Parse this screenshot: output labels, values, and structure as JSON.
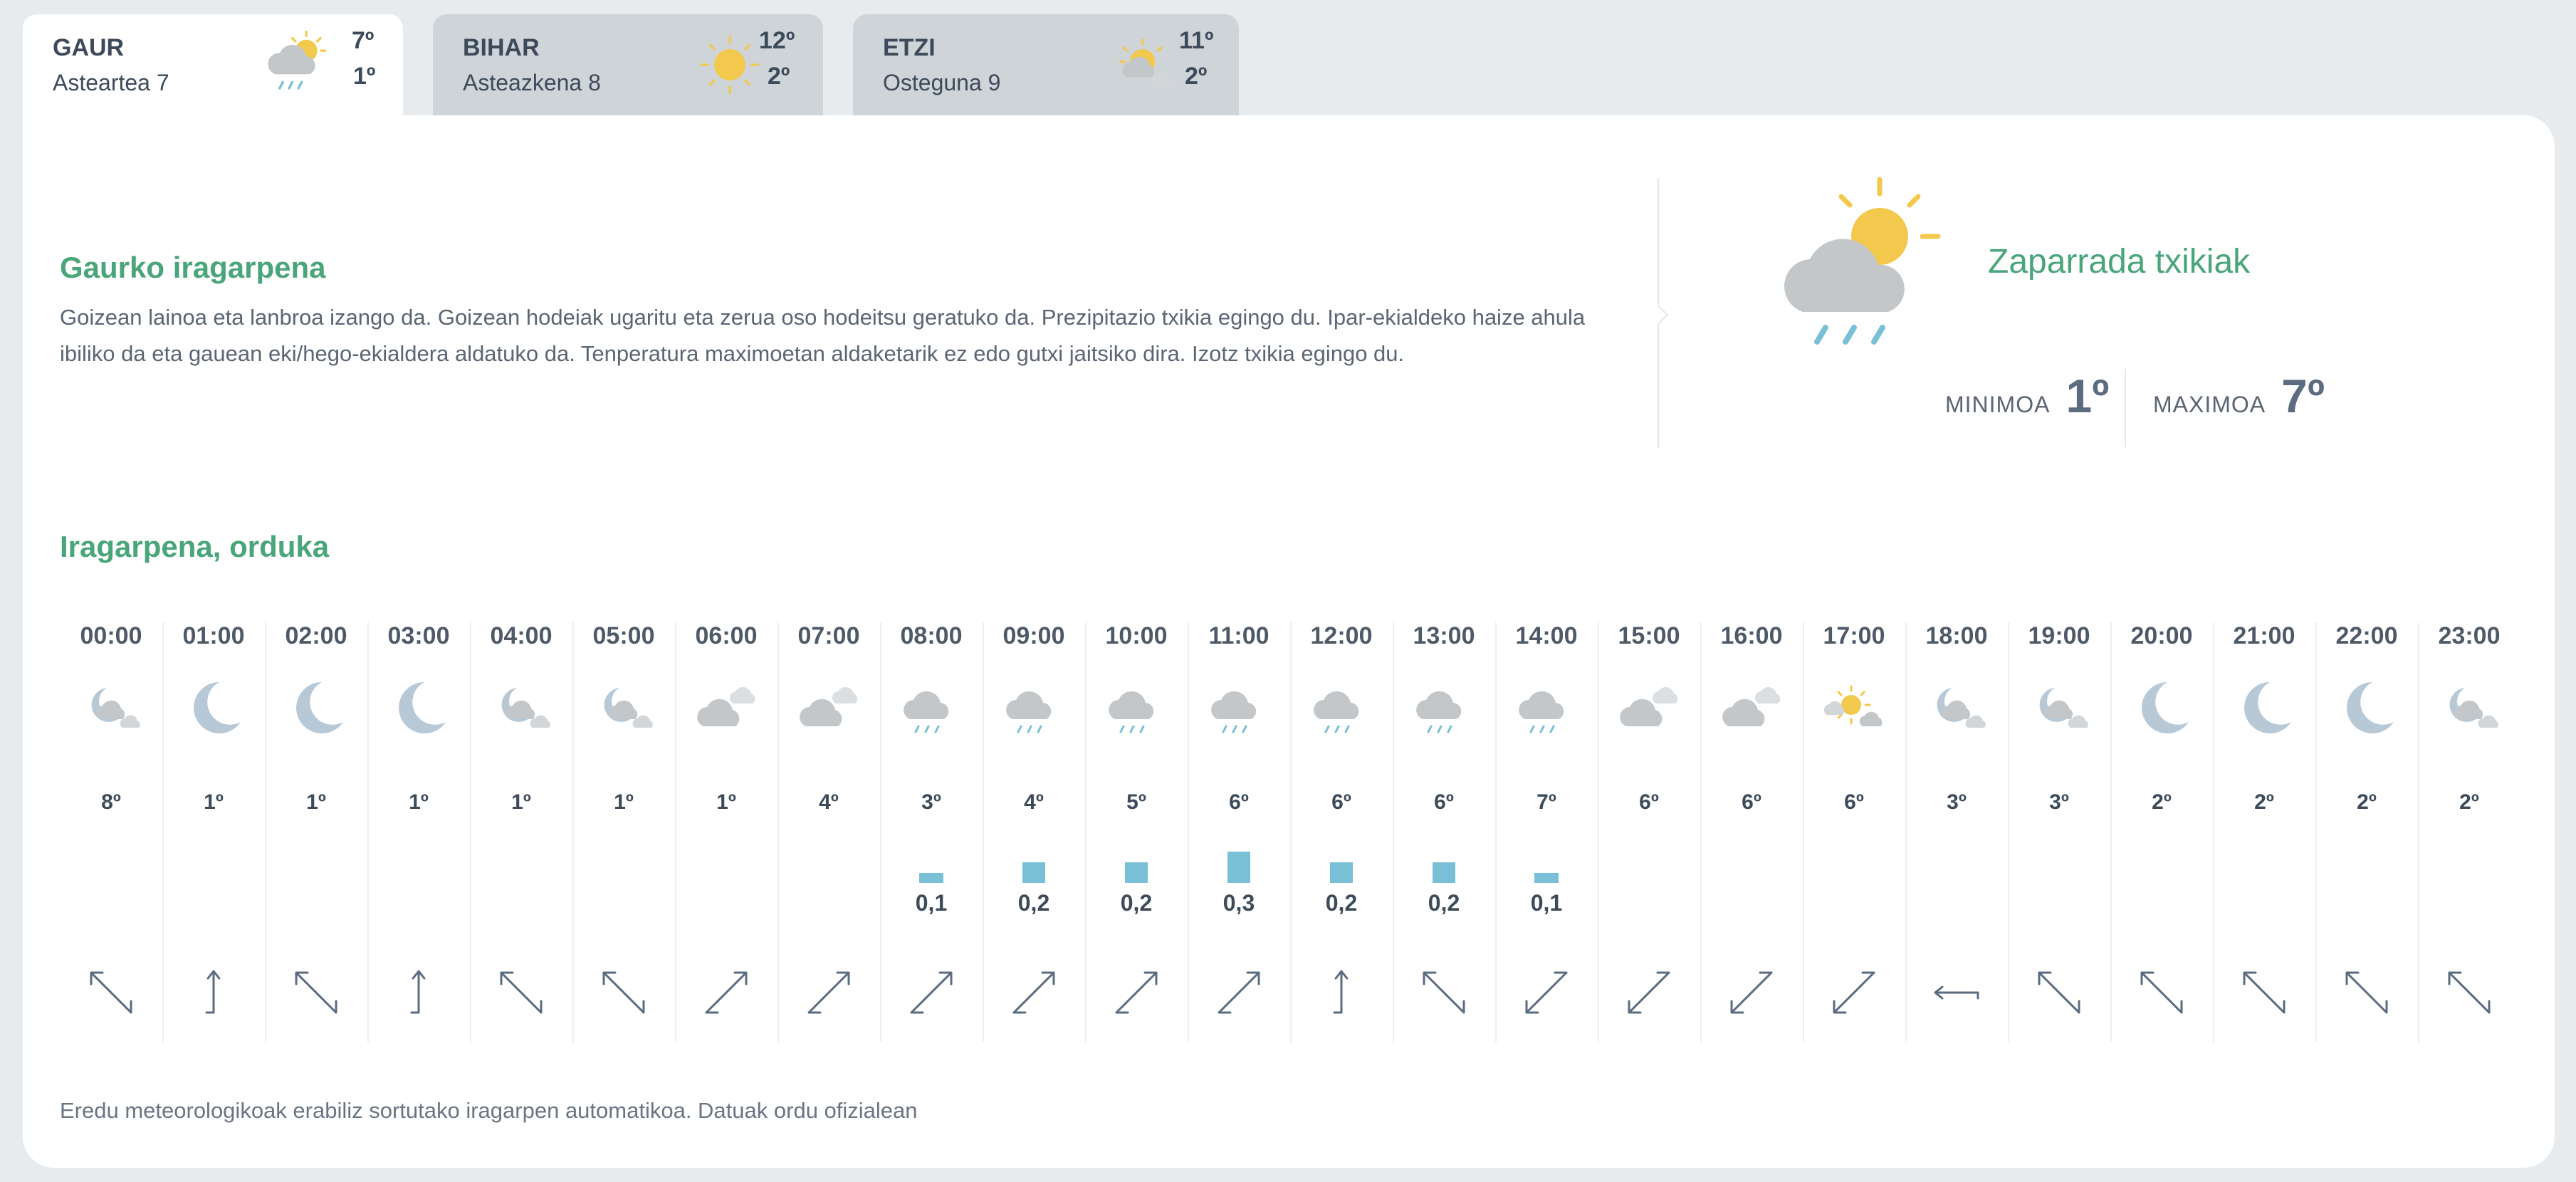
{
  "tabs": [
    {
      "name": "GAUR",
      "date": "Asteartea 7",
      "max": "7º",
      "min": "1º",
      "icon": "sun-cloud-rain-icon",
      "active": true
    },
    {
      "name": "BIHAR",
      "date": "Asteazkena 8",
      "max": "12º",
      "min": "2º",
      "icon": "sun-icon",
      "active": false
    },
    {
      "name": "ETZI",
      "date": "Osteguna 9",
      "max": "11º",
      "min": "2º",
      "icon": "sun-cloud-icon",
      "active": false
    }
  ],
  "today": {
    "title": "Gaurko iragarpena",
    "text": "Goizean lainoa eta lanbroa izango da. Goizean hodeiak ugaritu eta zerua oso hodeitsu geratuko da. Prezipitazio txikia egingo du. Ipar-ekialdeko haize ahula ibiliko da eta gauean eki/hego-ekialdera aldatuko da. Tenperatura maximoetan aldaketarik ez edo gutxi jaitsiko dira. Izotz txikia egingo du.",
    "condition": "Zaparrada txikiak",
    "min_label": "MINIMOA",
    "min_value": "1º",
    "max_label": "MAXIMOA",
    "max_value": "7º"
  },
  "hourly": {
    "title": "Iragarpena, orduka",
    "hours": [
      {
        "time": "00:00",
        "icon": "moon-cloud",
        "temp": "8º",
        "precip": "",
        "precip_value": 0,
        "wind": "nw"
      },
      {
        "time": "01:00",
        "icon": "moon",
        "temp": "1º",
        "precip": "",
        "precip_value": 0,
        "wind": "n"
      },
      {
        "time": "02:00",
        "icon": "moon",
        "temp": "1º",
        "precip": "",
        "precip_value": 0,
        "wind": "nw"
      },
      {
        "time": "03:00",
        "icon": "moon",
        "temp": "1º",
        "precip": "",
        "precip_value": 0,
        "wind": "n"
      },
      {
        "time": "04:00",
        "icon": "moon-cloud",
        "temp": "1º",
        "precip": "",
        "precip_value": 0,
        "wind": "nw"
      },
      {
        "time": "05:00",
        "icon": "moon-cloud",
        "temp": "1º",
        "precip": "",
        "precip_value": 0,
        "wind": "nw"
      },
      {
        "time": "06:00",
        "icon": "cloud",
        "temp": "1º",
        "precip": "",
        "precip_value": 0,
        "wind": "ne"
      },
      {
        "time": "07:00",
        "icon": "cloud",
        "temp": "4º",
        "precip": "",
        "precip_value": 0,
        "wind": "ne"
      },
      {
        "time": "08:00",
        "icon": "cloud-rain",
        "temp": "3º",
        "precip": "0,1",
        "precip_value": 0.1,
        "wind": "ne"
      },
      {
        "time": "09:00",
        "icon": "cloud-rain",
        "temp": "4º",
        "precip": "0,2",
        "precip_value": 0.2,
        "wind": "ne"
      },
      {
        "time": "10:00",
        "icon": "cloud-rain",
        "temp": "5º",
        "precip": "0,2",
        "precip_value": 0.2,
        "wind": "ne"
      },
      {
        "time": "11:00",
        "icon": "cloud-rain",
        "temp": "6º",
        "precip": "0,3",
        "precip_value": 0.3,
        "wind": "ne"
      },
      {
        "time": "12:00",
        "icon": "cloud-rain",
        "temp": "6º",
        "precip": "0,2",
        "precip_value": 0.2,
        "wind": "n"
      },
      {
        "time": "13:00",
        "icon": "cloud-rain",
        "temp": "6º",
        "precip": "0,2",
        "precip_value": 0.2,
        "wind": "nw"
      },
      {
        "time": "14:00",
        "icon": "cloud-rain",
        "temp": "7º",
        "precip": "0,1",
        "precip_value": 0.1,
        "wind": "se"
      },
      {
        "time": "15:00",
        "icon": "cloud",
        "temp": "6º",
        "precip": "",
        "precip_value": 0,
        "wind": "se"
      },
      {
        "time": "16:00",
        "icon": "cloud",
        "temp": "6º",
        "precip": "",
        "precip_value": 0,
        "wind": "se"
      },
      {
        "time": "17:00",
        "icon": "sun-cloud",
        "temp": "6º",
        "precip": "",
        "precip_value": 0,
        "wind": "se"
      },
      {
        "time": "18:00",
        "icon": "moon-cloud",
        "temp": "3º",
        "precip": "",
        "precip_value": 0,
        "wind": "w"
      },
      {
        "time": "19:00",
        "icon": "moon-cloud",
        "temp": "3º",
        "precip": "",
        "precip_value": 0,
        "wind": "nw"
      },
      {
        "time": "20:00",
        "icon": "moon",
        "temp": "2º",
        "precip": "",
        "precip_value": 0,
        "wind": "nw"
      },
      {
        "time": "21:00",
        "icon": "moon",
        "temp": "2º",
        "precip": "",
        "precip_value": 0,
        "wind": "nw"
      },
      {
        "time": "22:00",
        "icon": "moon",
        "temp": "2º",
        "precip": "",
        "precip_value": 0,
        "wind": "nw"
      },
      {
        "time": "23:00",
        "icon": "moon-cloud",
        "temp": "2º",
        "precip": "",
        "precip_value": 0,
        "wind": "nw"
      }
    ]
  },
  "footer_note": "Eredu meteorologikoak erabiliz sortutako iragarpen automatikoa. Datuak ordu ofizialean",
  "colors": {
    "accent_green": "#4aa57a",
    "rain_bar": "#79c0d6",
    "sun": "#f2c94c",
    "cloud": "#c4c7ca",
    "moon": "#b7c9d7"
  }
}
